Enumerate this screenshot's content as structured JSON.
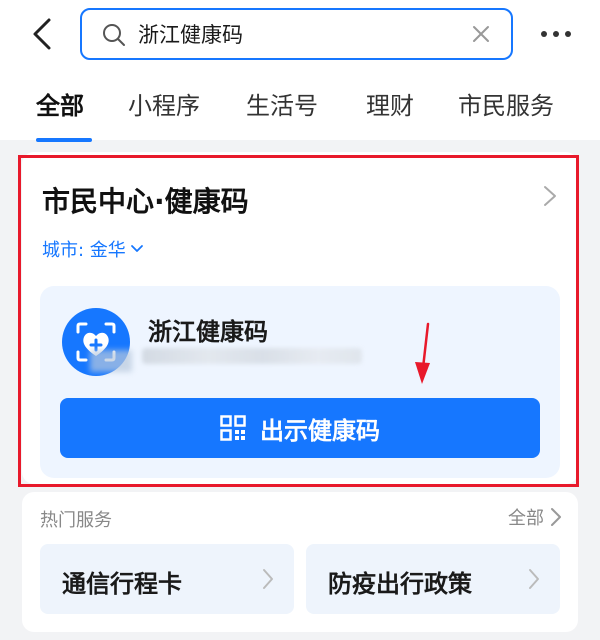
{
  "search": {
    "value": "浙江健康码"
  },
  "tabs": [
    {
      "label": "全部",
      "active": true
    },
    {
      "label": "小程序",
      "active": false
    },
    {
      "label": "生活号",
      "active": false
    },
    {
      "label": "理财",
      "active": false
    },
    {
      "label": "市民服务",
      "active": false
    }
  ],
  "result": {
    "title": "市民中心·健康码",
    "city_label": "城市: 金华",
    "app": {
      "name": "浙江健康码",
      "icon": "heart-scan-icon"
    },
    "primary_button": "出示健康码"
  },
  "hot_services": {
    "title": "热门服务",
    "all_label": "全部",
    "items": [
      {
        "label": "通信行程卡"
      },
      {
        "label": "防疫出行政策"
      }
    ]
  },
  "colors": {
    "accent": "#1677ff",
    "highlight": "#e8192b",
    "background": "#f2f3f5"
  }
}
